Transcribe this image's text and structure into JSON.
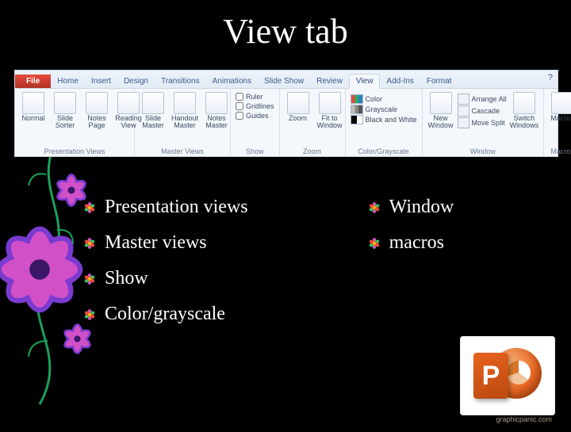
{
  "title": "View tab",
  "ribbon": {
    "tabs": [
      "File",
      "Home",
      "Insert",
      "Design",
      "Transitions",
      "Animations",
      "Slide Show",
      "Review",
      "View",
      "Add-Ins",
      "Format"
    ],
    "active_tab": "View",
    "help": "?",
    "groups": {
      "presentation_views": {
        "label": "Presentation Views",
        "buttons": [
          "Normal",
          "Slide Sorter",
          "Notes Page",
          "Reading View"
        ]
      },
      "master_views": {
        "label": "Master Views",
        "buttons": [
          "Slide Master",
          "Handout Master",
          "Notes Master"
        ]
      },
      "show": {
        "label": "Show",
        "checks": [
          "Ruler",
          "Gridlines",
          "Guides"
        ]
      },
      "zoom": {
        "label": "Zoom",
        "buttons": [
          "Zoom",
          "Fit to Window"
        ]
      },
      "color": {
        "label": "Color/Grayscale",
        "options": [
          "Color",
          "Grayscale",
          "Black and White"
        ]
      },
      "window": {
        "label": "Window",
        "big": "New Window",
        "stack": [
          "Arrange All",
          "Cascade",
          "Move Split"
        ],
        "switch": "Switch Windows"
      },
      "macros": {
        "label": "Macros",
        "button": "Macros"
      }
    }
  },
  "bullets": {
    "left": [
      "Presentation views",
      "Master views",
      "Show",
      "Color/grayscale"
    ],
    "right": [
      "Window",
      "macros"
    ]
  },
  "credit": "graphicpanic.com"
}
